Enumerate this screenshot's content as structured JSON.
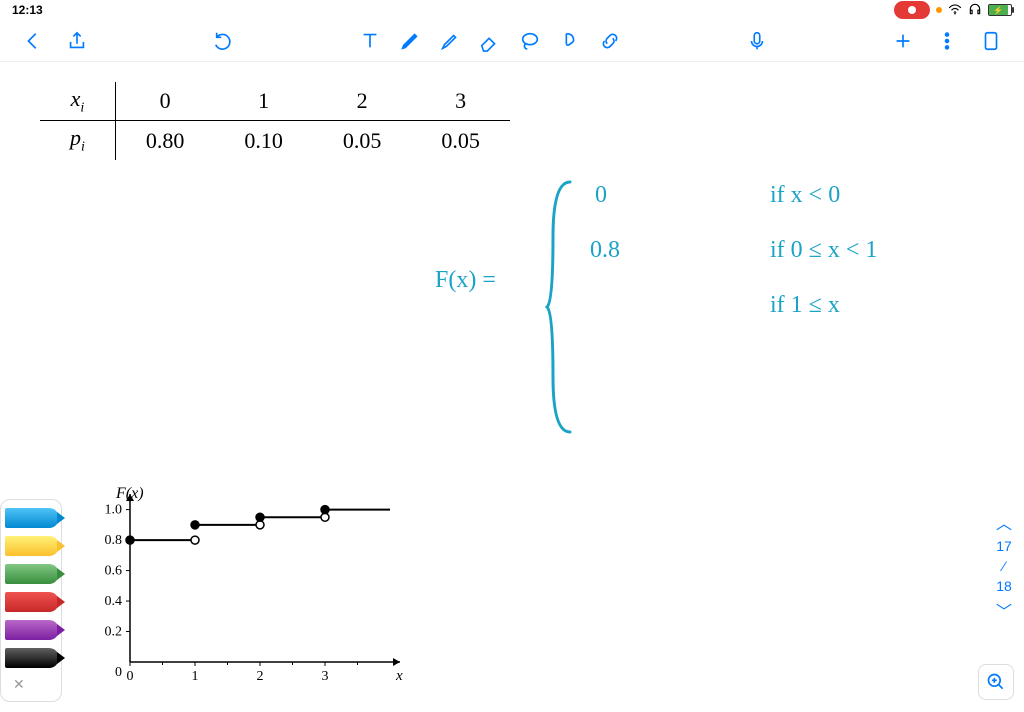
{
  "status": {
    "time": "12:13",
    "battery_icon": "⚡"
  },
  "toolbar": {
    "back": "‹",
    "share": "⇧",
    "undo": "↶",
    "mic": "🎙",
    "plus": "+",
    "more": "⋮",
    "pages": "▯"
  },
  "table": {
    "row_labels": {
      "x": "x",
      "x_sub": "i",
      "p": "p",
      "p_sub": "i"
    },
    "cols": [
      "0",
      "1",
      "2",
      "3"
    ],
    "probs": [
      "0.80",
      "0.10",
      "0.05",
      "0.05"
    ]
  },
  "hand": {
    "fx": "F(x)  =",
    "v1": "0",
    "c1": "if   x < 0",
    "v2": "0.8",
    "c2": "if   0 ≤ x < 1",
    "v3": "",
    "c3": "if   1 ≤ x"
  },
  "chart_data": {
    "type": "line",
    "title": "F(x)",
    "xlabel": "x",
    "ylabel": "",
    "x_ticks": [
      0,
      1,
      2,
      3
    ],
    "y_ticks": [
      0.2,
      0.4,
      0.6,
      0.8,
      1.0
    ],
    "xlim": [
      0,
      4
    ],
    "ylim": [
      0,
      1.05
    ],
    "step_segments": [
      {
        "from_x": 0,
        "to_x": 1,
        "y": 0.8,
        "closed_left": true,
        "closed_right": false
      },
      {
        "from_x": 1,
        "to_x": 2,
        "y": 0.9,
        "closed_left": true,
        "closed_right": false
      },
      {
        "from_x": 2,
        "to_x": 3,
        "y": 0.95,
        "closed_left": true,
        "closed_right": false
      },
      {
        "from_x": 3,
        "to_x": 4,
        "y": 1.0,
        "closed_left": true,
        "closed_right": false
      }
    ]
  },
  "page_nav": {
    "current": "17",
    "sep": "⁄",
    "total": "18"
  },
  "pens": [
    "blue",
    "yellow",
    "green",
    "red",
    "purple",
    "black"
  ]
}
